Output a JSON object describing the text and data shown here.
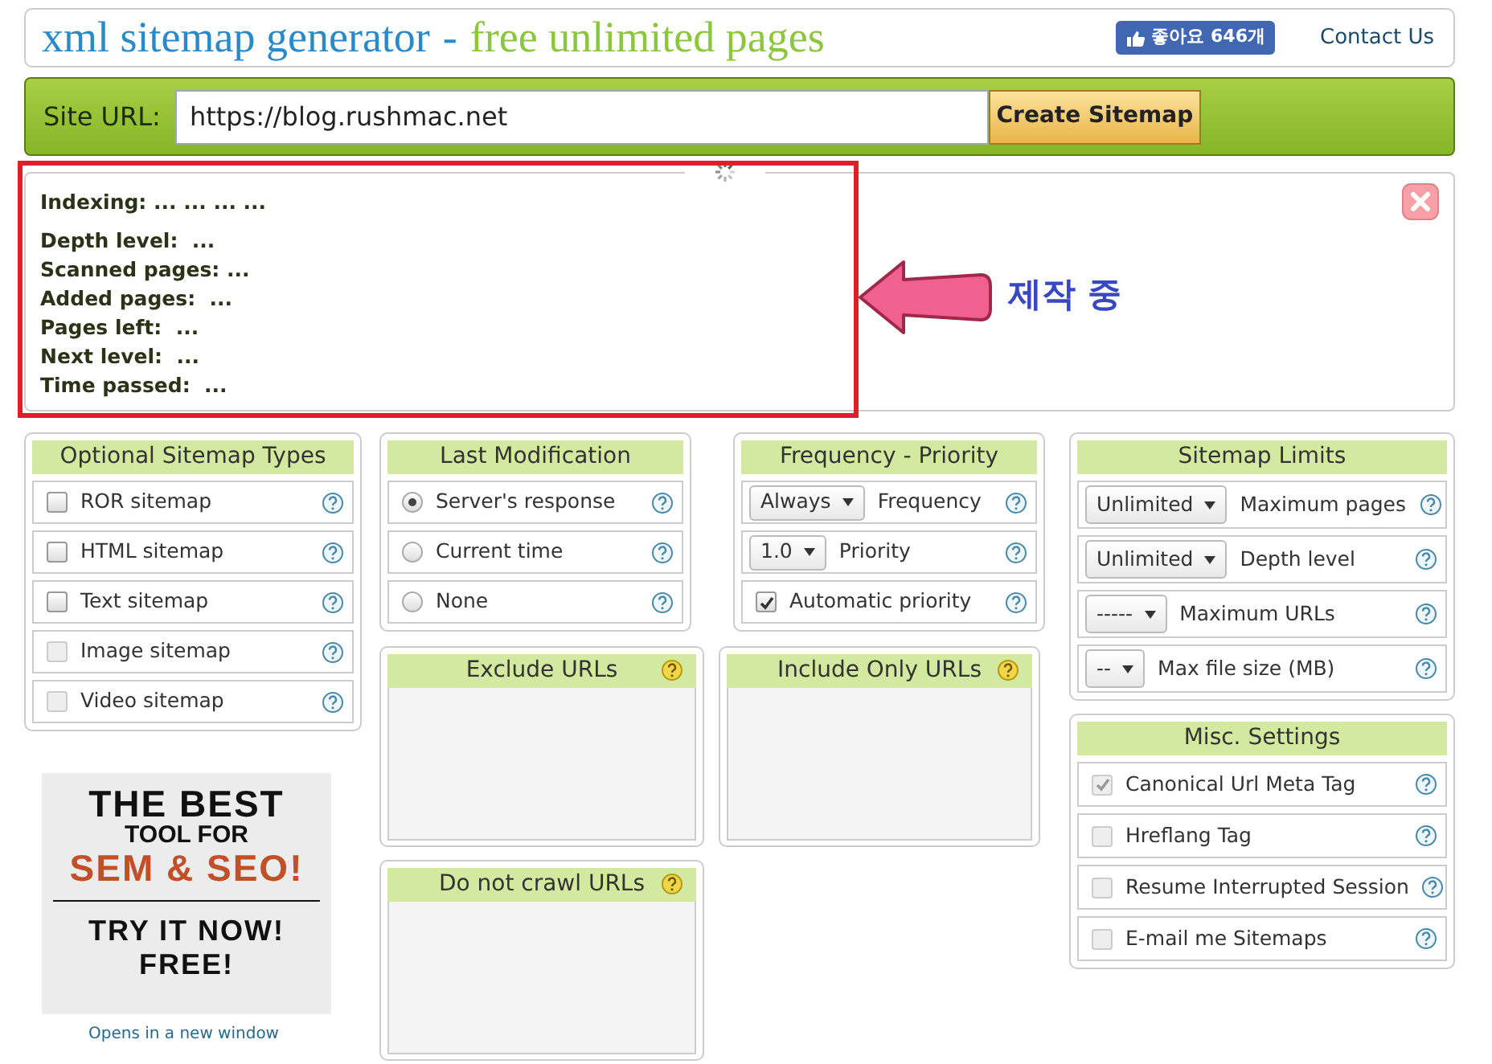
{
  "header": {
    "title": "xml sitemap generator",
    "separator": "-",
    "tagline": "free unlimited pages",
    "like_button": "좋아요 646개",
    "contact_link": "Contact Us"
  },
  "url_bar": {
    "label": "Site URL:",
    "value": "https://blog.rushmac.net",
    "button": "Create Sitemap"
  },
  "progress": {
    "indexing": "Indexing: ... ... ... ...",
    "stats": [
      "Depth level:  ...",
      "Scanned pages: ...",
      "Added pages:  ...",
      "Pages left:  ...",
      "Next level:  ...",
      "Time passed:  ..."
    ],
    "annotation": "제작 중"
  },
  "sitemap_types": {
    "title": "Optional Sitemap Types",
    "items": [
      {
        "label": "ROR sitemap",
        "checked": false,
        "disabled": false
      },
      {
        "label": "HTML sitemap",
        "checked": false,
        "disabled": false
      },
      {
        "label": "Text sitemap",
        "checked": false,
        "disabled": false
      },
      {
        "label": "Image sitemap",
        "checked": false,
        "disabled": true
      },
      {
        "label": "Video sitemap",
        "checked": false,
        "disabled": true
      }
    ]
  },
  "ad": {
    "lines": [
      {
        "text": "THE BEST",
        "kind": "large"
      },
      {
        "text": "TOOL FOR",
        "kind": "medium"
      },
      {
        "text": "SEM & SEO!",
        "kind": "accent"
      },
      {
        "text": "TRY IT NOW!",
        "kind": "cta"
      },
      {
        "text": "FREE!",
        "kind": "cta"
      }
    ],
    "caption": "Opens in a new window"
  },
  "last_modification": {
    "title": "Last Modification",
    "options": [
      {
        "label": "Server's response",
        "selected": true
      },
      {
        "label": "Current time",
        "selected": false
      },
      {
        "label": "None",
        "selected": false
      }
    ]
  },
  "frequency_priority": {
    "title": "Frequency - Priority",
    "rows": [
      {
        "kind": "select",
        "value": "Always",
        "label": "Frequency"
      },
      {
        "kind": "select",
        "value": "1.0",
        "label": "Priority"
      },
      {
        "kind": "checkbox",
        "label": "Automatic priority",
        "checked": true
      }
    ]
  },
  "url_filters": [
    {
      "title": "Exclude URLs"
    },
    {
      "title": "Include Only URLs"
    },
    {
      "title": "Do not crawl URLs"
    }
  ],
  "sitemap_limits": {
    "title": "Sitemap Limits",
    "rows": [
      {
        "value": "Unlimited",
        "label": "Maximum pages"
      },
      {
        "value": "Unlimited",
        "label": "Depth level"
      },
      {
        "value": "-----",
        "label": "Maximum URLs"
      },
      {
        "value": "--",
        "label": "Max file size (MB)"
      }
    ]
  },
  "misc_settings": {
    "title": "Misc. Settings",
    "items": [
      {
        "label": "Canonical Url Meta Tag",
        "checked": true,
        "disabled": true
      },
      {
        "label": "Hreflang Tag",
        "checked": false,
        "disabled": true
      },
      {
        "label": "Resume Interrupted Session",
        "checked": false,
        "disabled": true
      },
      {
        "label": "E-mail me Sitemaps",
        "checked": false,
        "disabled": true
      }
    ]
  }
}
